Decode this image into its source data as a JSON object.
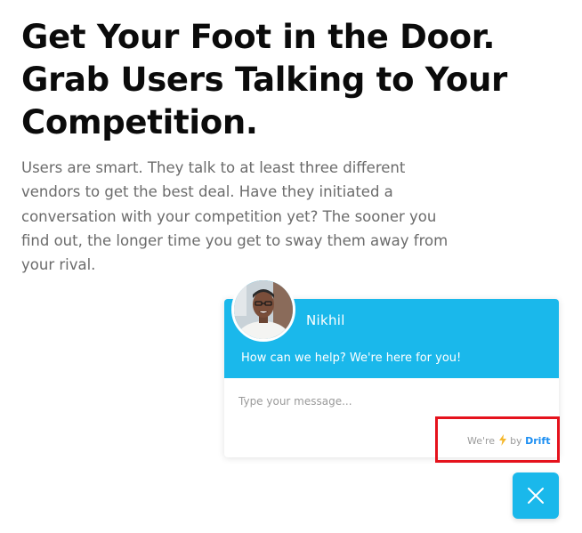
{
  "hero": {
    "title_lines": [
      "Get Your Foot in the Door.",
      "Grab Users Talking to Your",
      "Competition."
    ],
    "body_lines": [
      "Users are smart. They talk to at least three different",
      "vendors to get the best deal. Have they initiated a",
      "conversation with your competition yet? The sooner you",
      "find out, the longer time you get to sway them away from",
      "your rival."
    ]
  },
  "chat": {
    "agent_name": "Nikhil",
    "welcome_message": "How can we help? We're here for you!",
    "input_placeholder": "Type your message...",
    "powered_by_prefix": "We're",
    "powered_by_by": "by",
    "powered_by_brand": "Drift",
    "icons": [
      "bolt-icon",
      "close-icon"
    ],
    "colors": {
      "header": "#1ab8eb",
      "brand_link": "#1b8ef2",
      "bolt": "#f5b82e",
      "highlight": "#e5121c"
    }
  }
}
